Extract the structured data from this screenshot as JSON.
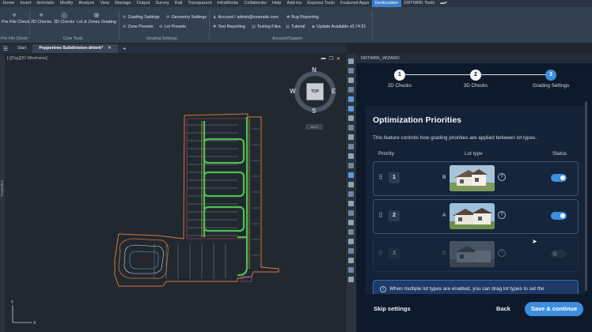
{
  "ribbon_tabs": [
    "Home",
    "Insert",
    "Annotate",
    "Modify",
    "Analyze",
    "View",
    "Manage",
    "Output",
    "Survey",
    "Rail",
    "Transparent",
    "InfraWorks",
    "Collaborate",
    "Help",
    "Add-ins",
    "Express Tools",
    "Featured Apps",
    "Geolocation",
    "DRTWRK Tools"
  ],
  "active_tab": "Geolocation",
  "ribbon": {
    "pre_file_check": "Pre File Check",
    "pre_file_check_group": "Pre File Check",
    "checks_2d": "2D Checks",
    "checks_3d": "3D Checks",
    "lot_zones": "Lot & Zones Grading",
    "core_tools_group": "Core Tools",
    "grading_settings": "Grading Settings",
    "geometry_settings": "Geometry Settings",
    "zone_presets": "Zone Presets",
    "lot_presets": "Lot Presets",
    "grading_settings_group": "Grading Settings",
    "account": "Account / admin@example.com",
    "bug_reporting": "Bug Reporting",
    "test_reporting": "Test Reporting",
    "testing_files": "Testing Files",
    "tutorial": "Tutorial",
    "update": "Update Available v0.74.91",
    "account_group": "Account/Support"
  },
  "doc_tabs": {
    "start": "Start",
    "active": "Peppertree-Subdivision-drtwrk*"
  },
  "viewport": {
    "label": "[-][Top][2D Wireframe]",
    "side_label": "Properties",
    "viewcube": {
      "top": "TOP",
      "n": "N",
      "s": "S",
      "e": "E",
      "w": "W",
      "wcs": "WCS"
    }
  },
  "wizard": {
    "header": "DRTWRK_WIZARD",
    "steps": [
      {
        "num": "1",
        "label": "2D Checks"
      },
      {
        "num": "2",
        "label": "3D Checks"
      },
      {
        "num": "3",
        "label": "Grading Settings"
      }
    ],
    "section_title": "Optimization Priorities",
    "section_desc": "This feature controls how grading priorities are applied between lot types.",
    "col_priority": "Priority",
    "col_lot_type": "Lot type",
    "col_status": "Status",
    "rows": [
      {
        "priority": "1",
        "lot": "B",
        "enabled": true
      },
      {
        "priority": "2",
        "lot": "A",
        "enabled": true
      },
      {
        "priority": "3",
        "lot": "C",
        "enabled": false
      }
    ],
    "info": "When multiple lot types are enabled, you can drag lot types to set the",
    "skip": "Skip settings",
    "back": "Back",
    "save": "Save & continue"
  },
  "colors": {
    "accent": "#3e8ee0",
    "toggle_on": "#3e8ee0",
    "toggle_off": "#3a4656",
    "step_active": "#3e8ee0"
  }
}
